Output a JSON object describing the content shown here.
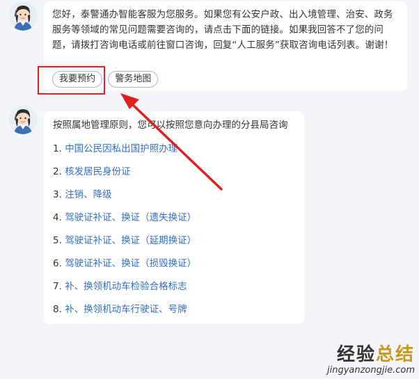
{
  "bot_message": {
    "text": "您好，泰警通办智能客服为您服务。如果您有公安户政、出入境管理、治安、政务服务等领域的常见问题需要咨询的，请点击下面的链接。如果我回答不了您的问题，请拨打咨询电话或前往窗口咨询，回复“人工服务”获取咨询电话列表。谢谢！",
    "buttons": [
      "我要预约",
      "警务地图"
    ]
  },
  "bot_reply": {
    "intro": "按照属地管理原则，您可以按照您意向办理的分县局咨询",
    "items": [
      {
        "num": "1.",
        "label": "中国公民因私出国护照办理"
      },
      {
        "num": "2.",
        "label": "核发居民身份证"
      },
      {
        "num": "3.",
        "label": "注销、降级"
      },
      {
        "num": "4.",
        "label": "驾驶证补证、换证（遗失换证）"
      },
      {
        "num": "5.",
        "label": "驾驶证补证、换证（延期换证）"
      },
      {
        "num": "6.",
        "label": "驾驶证补证、换证（损毁换证）"
      },
      {
        "num": "7.",
        "label": "补、换领机动车检验合格标志"
      },
      {
        "num": "8.",
        "label": "补、换领机动车行驶证、号牌"
      }
    ]
  },
  "watermark": {
    "title_part1": "经验",
    "title_part2": "总结",
    "url": "jingyanzongjie.com"
  },
  "colors": {
    "accent_link": "#2f6fc6",
    "highlight": "#e02020",
    "chip_border": "#b9a9e3",
    "background": "#f4f5f9"
  }
}
